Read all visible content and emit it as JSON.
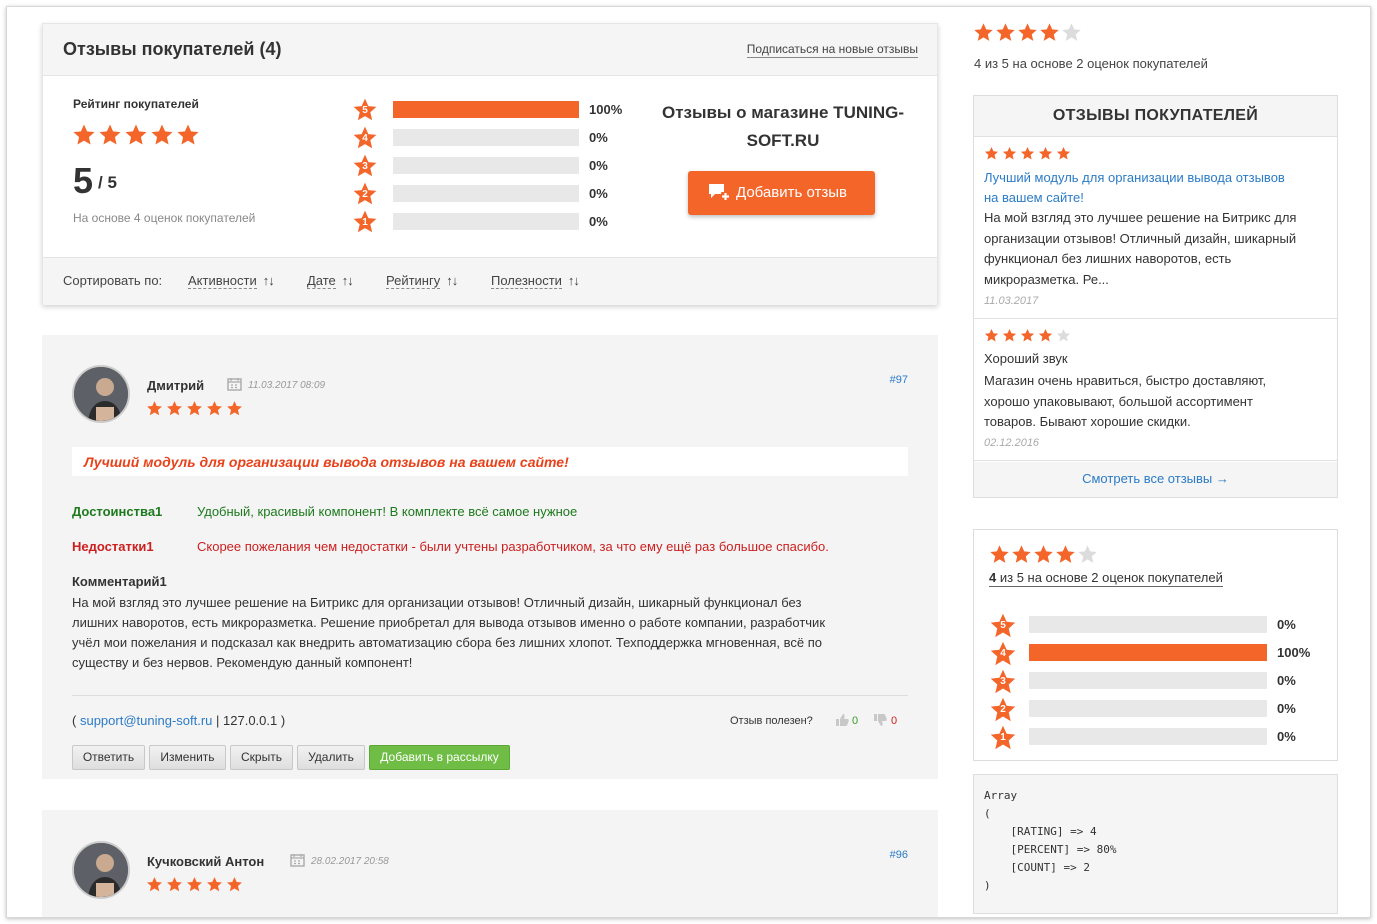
{
  "summary": {
    "title": "Отзывы покупателей (4)",
    "subscribe": "Подписаться на новые отзывы",
    "rating_label": "Рейтинг покупателей",
    "rating_value": "5",
    "rating_of": "/ 5",
    "based_on": "На основе 4 оценок покупателей",
    "stars": 5,
    "dist": [
      {
        "star": "5",
        "percent": 100,
        "label": "100%"
      },
      {
        "star": "4",
        "percent": 0,
        "label": "0%"
      },
      {
        "star": "3",
        "percent": 0,
        "label": "0%"
      },
      {
        "star": "2",
        "percent": 0,
        "label": "0%"
      },
      {
        "star": "1",
        "percent": 0,
        "label": "0%"
      }
    ],
    "shop_title_1": "Отзывы о магазине TUNING-",
    "shop_title_2": "SOFT.RU",
    "add_review": "Добавить отзыв",
    "sort_label": "Сортировать по:",
    "sort": [
      "Активности",
      "Дате",
      "Рейтингу",
      "Полезности"
    ],
    "sort_arrow": "↑↓"
  },
  "reviews": [
    {
      "author": "Дмитрий",
      "date": "11.03.2017 08:09",
      "id": "#97",
      "stars": 5,
      "title": "Лучший модуль для организации вывода отзывов на вашем сайте!",
      "pros_label": "Достоинства1",
      "pros": "Удобный, красивый компонент! В комплекте всё самое нужное",
      "cons_label": "Недостатки1",
      "cons": "Скорее пожелания чем недостатки - были учтены разработчиком, за что ему ещё раз большое спасибо.",
      "comment_label": "Комментарий1",
      "comment_lines": [
        "На мой взгляд это лучшее решение на Битрикс для организации отзывов! Отличный дизайн, шикарный функционал без",
        "лишних наворотов, есть микроразметка. Решение приобретал для вывода отзывов именно о работе компании, разработчик",
        "учёл мои пожелания и подсказал как внедрить автоматизацию сбора без лишних хлопот. Техподдержка мгновенная, всё по",
        "существу и без нервов. Рекомендую данный компонент!"
      ],
      "contact_open": "(",
      "email": "support@tuning-soft.ru",
      "ip": "| 127.0.0.1 )",
      "helpful_label": "Отзыв полезен?",
      "likes": "0",
      "dislikes": "0",
      "buttons": {
        "reply": "Ответить",
        "edit": "Изменить",
        "hide": "Скрыть",
        "delete": "Удалить",
        "mailing": "Добавить в рассылку"
      }
    },
    {
      "author": "Кучковский Антон",
      "date": "28.02.2017 20:58",
      "id": "#96",
      "stars": 5
    }
  ],
  "sidebar": {
    "top_stars": 4,
    "top_text": "4 из 5 на основе 2 оценок покупателей",
    "box_title": "ОТЗЫВЫ ПОКУПАТЕЛЕЙ",
    "items": [
      {
        "stars": 5,
        "title_1": "Лучший модуль для организации вывода отзывов",
        "title_2": "на вашем сайте!",
        "text": [
          "На мой взгляд это лучшее решение на Битрикс для",
          "организации отзывов! Отличный дизайн, шикарный",
          "функционал без лишних наворотов, есть",
          "микроразметка. Ре..."
        ],
        "date": "11.03.2017"
      },
      {
        "stars": 4,
        "title_1": "Хороший звук",
        "text": [
          "Магазин очень нравиться, быстро доставляют,",
          "хорошо упаковывают, большой ассортимент",
          "товаров. Бывают хорошие скидки."
        ],
        "date": "02.12.2016"
      }
    ],
    "see_all": "Смотреть все отзывы →",
    "widget": {
      "stars": 4,
      "score": "4",
      "text": "из 5 на основе 2 оценок покупателей",
      "dist": [
        {
          "star": "5",
          "percent": 0,
          "label": "0%"
        },
        {
          "star": "4",
          "percent": 100,
          "label": "100%"
        },
        {
          "star": "3",
          "percent": 0,
          "label": "0%"
        },
        {
          "star": "2",
          "percent": 0,
          "label": "0%"
        },
        {
          "star": "1",
          "percent": 0,
          "label": "0%"
        }
      ]
    },
    "code_lines": [
      "Array",
      "(",
      "    [RATING] => 4",
      "    [PERCENT] => 80%",
      "    [COUNT] => 2",
      ")"
    ]
  },
  "colors": {
    "accent": "#f4652a",
    "star_empty": "#dcdcdc",
    "link": "#2b7bc7",
    "pros": "#1d7a1d",
    "cons": "#cc1f1f",
    "green_button": "#6fbd45"
  }
}
